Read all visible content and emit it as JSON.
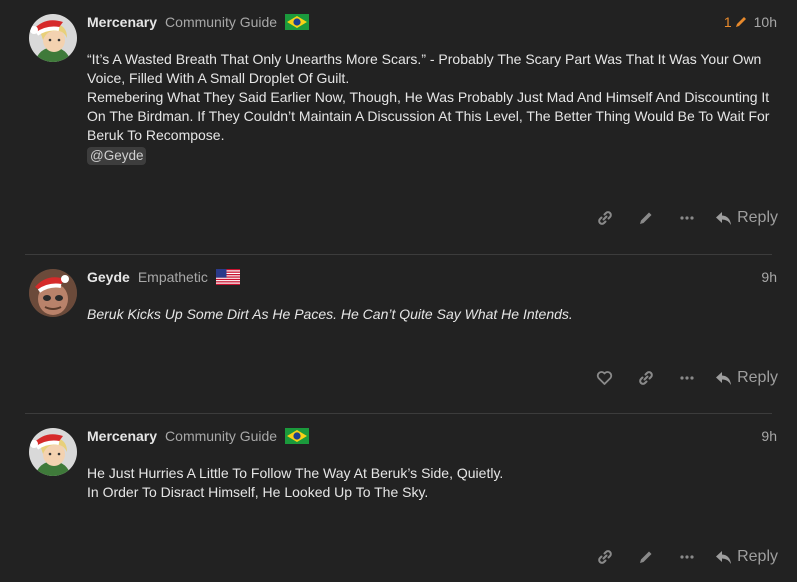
{
  "posts": [
    {
      "username": "Mercenary",
      "user_title": "Community Guide",
      "flag_icon": "brazil-flag-icon",
      "edit_count": "1",
      "time": "10h",
      "paragraphs": [
        "“It’s A Wasted Breath That Only Unearths More Scars.” - Probably The Scary Part Was That It Was Your Own Voice, Filled With A Small Droplet Of Guilt.",
        "Remebering What They Said Earlier Now, Though, He Was Probably Just Mad And Himself And Discounting It On The Birdman. If They Couldn’t Maintain A Discussion At This Level, The Better Thing Would Be To Wait For Beruk To Recompose."
      ],
      "mention": "@Geyde",
      "reply_label": "Reply"
    },
    {
      "username": "Geyde",
      "user_title": "Empathetic",
      "flag_icon": "usa-flag-icon",
      "time": "9h",
      "paragraphs": [
        "Beruk Kicks Up Some Dirt As He Paces. He Can’t Quite Say What He Intends."
      ],
      "reply_label": "Reply"
    },
    {
      "username": "Mercenary",
      "user_title": "Community Guide",
      "flag_icon": "brazil-flag-icon",
      "time": "9h",
      "paragraphs": [
        "He Just Hurries A Little To Follow The Way At Beruk’s Side, Quietly.",
        "In Order To Disract Himself, He Looked Up To The Sky."
      ],
      "reply_label": "Reply"
    }
  ],
  "colors": {
    "background": "#222222",
    "text": "#e6e6e6",
    "muted": "#a8a8a8",
    "edit_accent": "#e88a2c"
  }
}
